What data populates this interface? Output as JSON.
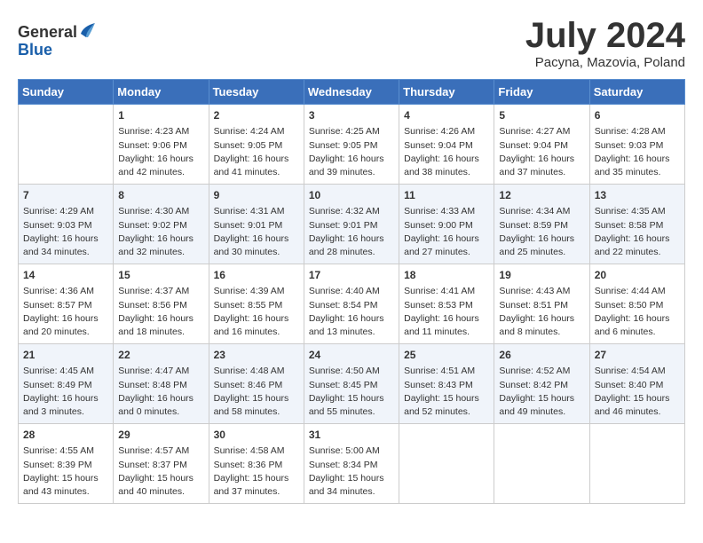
{
  "header": {
    "logo_line1": "General",
    "logo_line2": "Blue",
    "month_year": "July 2024",
    "location": "Pacyna, Mazovia, Poland"
  },
  "weekdays": [
    "Sunday",
    "Monday",
    "Tuesday",
    "Wednesday",
    "Thursday",
    "Friday",
    "Saturday"
  ],
  "weeks": [
    [
      {
        "day": "",
        "info": ""
      },
      {
        "day": "1",
        "info": "Sunrise: 4:23 AM\nSunset: 9:06 PM\nDaylight: 16 hours\nand 42 minutes."
      },
      {
        "day": "2",
        "info": "Sunrise: 4:24 AM\nSunset: 9:05 PM\nDaylight: 16 hours\nand 41 minutes."
      },
      {
        "day": "3",
        "info": "Sunrise: 4:25 AM\nSunset: 9:05 PM\nDaylight: 16 hours\nand 39 minutes."
      },
      {
        "day": "4",
        "info": "Sunrise: 4:26 AM\nSunset: 9:04 PM\nDaylight: 16 hours\nand 38 minutes."
      },
      {
        "day": "5",
        "info": "Sunrise: 4:27 AM\nSunset: 9:04 PM\nDaylight: 16 hours\nand 37 minutes."
      },
      {
        "day": "6",
        "info": "Sunrise: 4:28 AM\nSunset: 9:03 PM\nDaylight: 16 hours\nand 35 minutes."
      }
    ],
    [
      {
        "day": "7",
        "info": "Sunrise: 4:29 AM\nSunset: 9:03 PM\nDaylight: 16 hours\nand 34 minutes."
      },
      {
        "day": "8",
        "info": "Sunrise: 4:30 AM\nSunset: 9:02 PM\nDaylight: 16 hours\nand 32 minutes."
      },
      {
        "day": "9",
        "info": "Sunrise: 4:31 AM\nSunset: 9:01 PM\nDaylight: 16 hours\nand 30 minutes."
      },
      {
        "day": "10",
        "info": "Sunrise: 4:32 AM\nSunset: 9:01 PM\nDaylight: 16 hours\nand 28 minutes."
      },
      {
        "day": "11",
        "info": "Sunrise: 4:33 AM\nSunset: 9:00 PM\nDaylight: 16 hours\nand 27 minutes."
      },
      {
        "day": "12",
        "info": "Sunrise: 4:34 AM\nSunset: 8:59 PM\nDaylight: 16 hours\nand 25 minutes."
      },
      {
        "day": "13",
        "info": "Sunrise: 4:35 AM\nSunset: 8:58 PM\nDaylight: 16 hours\nand 22 minutes."
      }
    ],
    [
      {
        "day": "14",
        "info": "Sunrise: 4:36 AM\nSunset: 8:57 PM\nDaylight: 16 hours\nand 20 minutes."
      },
      {
        "day": "15",
        "info": "Sunrise: 4:37 AM\nSunset: 8:56 PM\nDaylight: 16 hours\nand 18 minutes."
      },
      {
        "day": "16",
        "info": "Sunrise: 4:39 AM\nSunset: 8:55 PM\nDaylight: 16 hours\nand 16 minutes."
      },
      {
        "day": "17",
        "info": "Sunrise: 4:40 AM\nSunset: 8:54 PM\nDaylight: 16 hours\nand 13 minutes."
      },
      {
        "day": "18",
        "info": "Sunrise: 4:41 AM\nSunset: 8:53 PM\nDaylight: 16 hours\nand 11 minutes."
      },
      {
        "day": "19",
        "info": "Sunrise: 4:43 AM\nSunset: 8:51 PM\nDaylight: 16 hours\nand 8 minutes."
      },
      {
        "day": "20",
        "info": "Sunrise: 4:44 AM\nSunset: 8:50 PM\nDaylight: 16 hours\nand 6 minutes."
      }
    ],
    [
      {
        "day": "21",
        "info": "Sunrise: 4:45 AM\nSunset: 8:49 PM\nDaylight: 16 hours\nand 3 minutes."
      },
      {
        "day": "22",
        "info": "Sunrise: 4:47 AM\nSunset: 8:48 PM\nDaylight: 16 hours\nand 0 minutes."
      },
      {
        "day": "23",
        "info": "Sunrise: 4:48 AM\nSunset: 8:46 PM\nDaylight: 15 hours\nand 58 minutes."
      },
      {
        "day": "24",
        "info": "Sunrise: 4:50 AM\nSunset: 8:45 PM\nDaylight: 15 hours\nand 55 minutes."
      },
      {
        "day": "25",
        "info": "Sunrise: 4:51 AM\nSunset: 8:43 PM\nDaylight: 15 hours\nand 52 minutes."
      },
      {
        "day": "26",
        "info": "Sunrise: 4:52 AM\nSunset: 8:42 PM\nDaylight: 15 hours\nand 49 minutes."
      },
      {
        "day": "27",
        "info": "Sunrise: 4:54 AM\nSunset: 8:40 PM\nDaylight: 15 hours\nand 46 minutes."
      }
    ],
    [
      {
        "day": "28",
        "info": "Sunrise: 4:55 AM\nSunset: 8:39 PM\nDaylight: 15 hours\nand 43 minutes."
      },
      {
        "day": "29",
        "info": "Sunrise: 4:57 AM\nSunset: 8:37 PM\nDaylight: 15 hours\nand 40 minutes."
      },
      {
        "day": "30",
        "info": "Sunrise: 4:58 AM\nSunset: 8:36 PM\nDaylight: 15 hours\nand 37 minutes."
      },
      {
        "day": "31",
        "info": "Sunrise: 5:00 AM\nSunset: 8:34 PM\nDaylight: 15 hours\nand 34 minutes."
      },
      {
        "day": "",
        "info": ""
      },
      {
        "day": "",
        "info": ""
      },
      {
        "day": "",
        "info": ""
      }
    ]
  ]
}
